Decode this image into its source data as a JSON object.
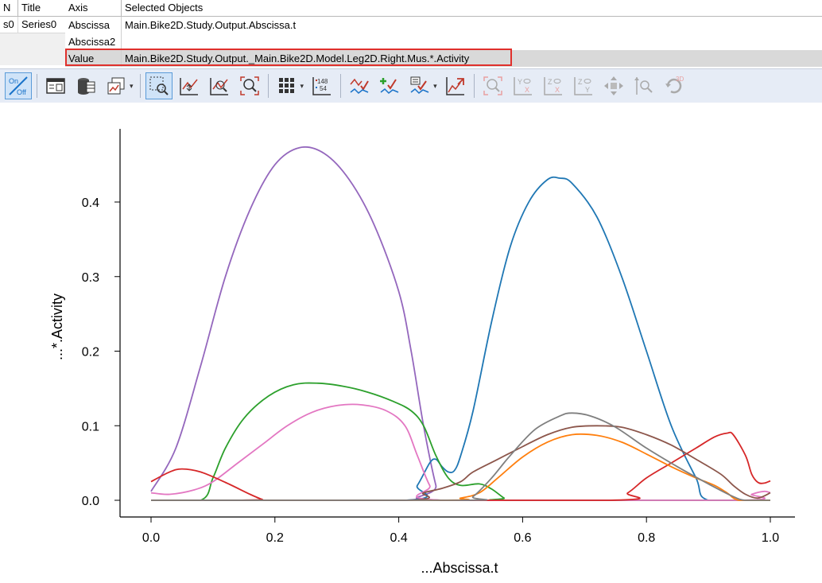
{
  "series_table": {
    "headers": {
      "n": "N",
      "title": "Title"
    },
    "rows": [
      {
        "n": "s0",
        "title": "Series0"
      }
    ]
  },
  "axis_table": {
    "headers": {
      "axis": "Axis",
      "objects": "Selected Objects"
    },
    "rows": [
      {
        "axis": "Abscissa",
        "objects": "Main.Bike2D.Study.Output.Abscissa.t"
      },
      {
        "axis": "Abscissa2",
        "objects": ""
      },
      {
        "axis": "Value",
        "objects": "Main.Bike2D.Study.Output._Main.Bike2D.Model.Leg2D.Right.Mus.*.Activity"
      }
    ]
  },
  "toolbar": {
    "onoff": {
      "on": "On",
      "off": "Off"
    },
    "number_top": "148",
    "number_bottom": "54",
    "label_3d": "3D",
    "icons": [
      "on-off-icon",
      "table-view-icon",
      "database-icon",
      "copy-chart-icon",
      "zoom-rectangle-icon",
      "pan-icon",
      "zoom-in-icon",
      "zoom-out-icon",
      "grid-icon",
      "number-format-icon",
      "series-style-icon",
      "add-series-icon",
      "edit-series-icon",
      "export-icon",
      "zoom-fit-icon",
      "yx-view-icon",
      "zx-view-icon",
      "zy-view-icon",
      "move-icon",
      "zoom-axis-icon",
      "rotate-3d-icon"
    ]
  },
  "chart_data": {
    "type": "line",
    "xlabel": "...Abscissa.t",
    "ylabel": "...*.Activity",
    "xlim": [
      -0.05,
      1.02
    ],
    "ylim": [
      -0.025,
      0.5
    ],
    "xticks": [
      "0.0",
      "0.2",
      "0.4",
      "0.6",
      "0.8",
      "1.0"
    ],
    "yticks": [
      "0.0",
      "0.1",
      "0.2",
      "0.3",
      "0.4"
    ],
    "series": [
      {
        "color": "#9467bd",
        "points": [
          [
            0,
            0.012
          ],
          [
            0.04,
            0.07
          ],
          [
            0.08,
            0.18
          ],
          [
            0.12,
            0.3
          ],
          [
            0.16,
            0.39
          ],
          [
            0.2,
            0.45
          ],
          [
            0.24,
            0.473
          ],
          [
            0.28,
            0.465
          ],
          [
            0.32,
            0.43
          ],
          [
            0.36,
            0.37
          ],
          [
            0.4,
            0.28
          ],
          [
            0.42,
            0.2
          ],
          [
            0.44,
            0.1
          ],
          [
            0.46,
            0.02
          ],
          [
            0.47,
            0.0
          ],
          [
            1.0,
            0.0
          ]
        ]
      },
      {
        "color": "#1f77b4",
        "points": [
          [
            0,
            0.0
          ],
          [
            0.41,
            0.0
          ],
          [
            0.43,
            0.02
          ],
          [
            0.45,
            0.05
          ],
          [
            0.46,
            0.055
          ],
          [
            0.47,
            0.045
          ],
          [
            0.48,
            0.038
          ],
          [
            0.49,
            0.04
          ],
          [
            0.5,
            0.06
          ],
          [
            0.52,
            0.12
          ],
          [
            0.55,
            0.24
          ],
          [
            0.58,
            0.34
          ],
          [
            0.61,
            0.4
          ],
          [
            0.64,
            0.43
          ],
          [
            0.66,
            0.432
          ],
          [
            0.68,
            0.425
          ],
          [
            0.72,
            0.38
          ],
          [
            0.76,
            0.3
          ],
          [
            0.8,
            0.2
          ],
          [
            0.84,
            0.1
          ],
          [
            0.88,
            0.03
          ],
          [
            0.9,
            0.0
          ],
          [
            1.0,
            0.0
          ]
        ]
      },
      {
        "color": "#2ca02c",
        "points": [
          [
            0,
            0.0
          ],
          [
            0.08,
            0.0
          ],
          [
            0.1,
            0.03
          ],
          [
            0.12,
            0.07
          ],
          [
            0.15,
            0.11
          ],
          [
            0.19,
            0.14
          ],
          [
            0.23,
            0.155
          ],
          [
            0.27,
            0.157
          ],
          [
            0.31,
            0.153
          ],
          [
            0.35,
            0.145
          ],
          [
            0.39,
            0.133
          ],
          [
            0.42,
            0.12
          ],
          [
            0.44,
            0.1
          ],
          [
            0.46,
            0.06
          ],
          [
            0.48,
            0.03
          ],
          [
            0.5,
            0.02
          ],
          [
            0.53,
            0.022
          ],
          [
            0.55,
            0.015
          ],
          [
            0.57,
            0.003
          ],
          [
            0.58,
            0.0
          ],
          [
            1.0,
            0.0
          ]
        ]
      },
      {
        "color": "#e377c2",
        "points": [
          [
            0,
            0.01
          ],
          [
            0.03,
            0.008
          ],
          [
            0.07,
            0.014
          ],
          [
            0.1,
            0.025
          ],
          [
            0.14,
            0.05
          ],
          [
            0.18,
            0.075
          ],
          [
            0.22,
            0.1
          ],
          [
            0.26,
            0.118
          ],
          [
            0.3,
            0.127
          ],
          [
            0.34,
            0.128
          ],
          [
            0.38,
            0.12
          ],
          [
            0.41,
            0.1
          ],
          [
            0.43,
            0.06
          ],
          [
            0.45,
            0.02
          ],
          [
            0.47,
            0.0
          ],
          [
            0.95,
            0.0
          ],
          [
            0.97,
            0.008
          ],
          [
            0.99,
            0.012
          ],
          [
            1.0,
            0.01
          ]
        ]
      },
      {
        "color": "#d62728",
        "points": [
          [
            0,
            0.025
          ],
          [
            0.03,
            0.038
          ],
          [
            0.05,
            0.042
          ],
          [
            0.08,
            0.038
          ],
          [
            0.12,
            0.024
          ],
          [
            0.16,
            0.008
          ],
          [
            0.18,
            0.001
          ],
          [
            0.19,
            0.0
          ],
          [
            0.74,
            0.0
          ],
          [
            0.77,
            0.01
          ],
          [
            0.8,
            0.03
          ],
          [
            0.84,
            0.05
          ],
          [
            0.88,
            0.07
          ],
          [
            0.91,
            0.085
          ],
          [
            0.93,
            0.09
          ],
          [
            0.94,
            0.088
          ],
          [
            0.96,
            0.06
          ],
          [
            0.97,
            0.035
          ],
          [
            0.98,
            0.024
          ],
          [
            0.99,
            0.023
          ],
          [
            1.0,
            0.026
          ]
        ]
      },
      {
        "color": "#ff7f0e",
        "points": [
          [
            0,
            0.0
          ],
          [
            0.47,
            0.0
          ],
          [
            0.5,
            0.003
          ],
          [
            0.53,
            0.01
          ],
          [
            0.56,
            0.03
          ],
          [
            0.6,
            0.058
          ],
          [
            0.64,
            0.078
          ],
          [
            0.68,
            0.088
          ],
          [
            0.72,
            0.087
          ],
          [
            0.76,
            0.078
          ],
          [
            0.8,
            0.062
          ],
          [
            0.84,
            0.045
          ],
          [
            0.88,
            0.03
          ],
          [
            0.91,
            0.02
          ],
          [
            0.93,
            0.01
          ],
          [
            0.95,
            0.0
          ],
          [
            1.0,
            0.0
          ]
        ]
      },
      {
        "color": "#8c564b",
        "points": [
          [
            0,
            0.0
          ],
          [
            0.41,
            0.0
          ],
          [
            0.44,
            0.01
          ],
          [
            0.47,
            0.016
          ],
          [
            0.5,
            0.025
          ],
          [
            0.52,
            0.038
          ],
          [
            0.56,
            0.055
          ],
          [
            0.6,
            0.072
          ],
          [
            0.64,
            0.088
          ],
          [
            0.68,
            0.098
          ],
          [
            0.72,
            0.1
          ],
          [
            0.76,
            0.098
          ],
          [
            0.8,
            0.088
          ],
          [
            0.84,
            0.074
          ],
          [
            0.88,
            0.055
          ],
          [
            0.92,
            0.035
          ],
          [
            0.94,
            0.02
          ],
          [
            0.96,
            0.008
          ],
          [
            0.98,
            0.003
          ],
          [
            1.0,
            0.01
          ]
        ]
      },
      {
        "color": "#7f7f7f",
        "points": [
          [
            0,
            0.0
          ],
          [
            0.5,
            0.0
          ],
          [
            0.52,
            0.005
          ],
          [
            0.55,
            0.03
          ],
          [
            0.58,
            0.06
          ],
          [
            0.62,
            0.095
          ],
          [
            0.66,
            0.113
          ],
          [
            0.68,
            0.117
          ],
          [
            0.71,
            0.113
          ],
          [
            0.75,
            0.098
          ],
          [
            0.8,
            0.07
          ],
          [
            0.85,
            0.045
          ],
          [
            0.9,
            0.022
          ],
          [
            0.94,
            0.005
          ],
          [
            0.96,
            0.0
          ],
          [
            1.0,
            0.0
          ]
        ]
      }
    ]
  }
}
